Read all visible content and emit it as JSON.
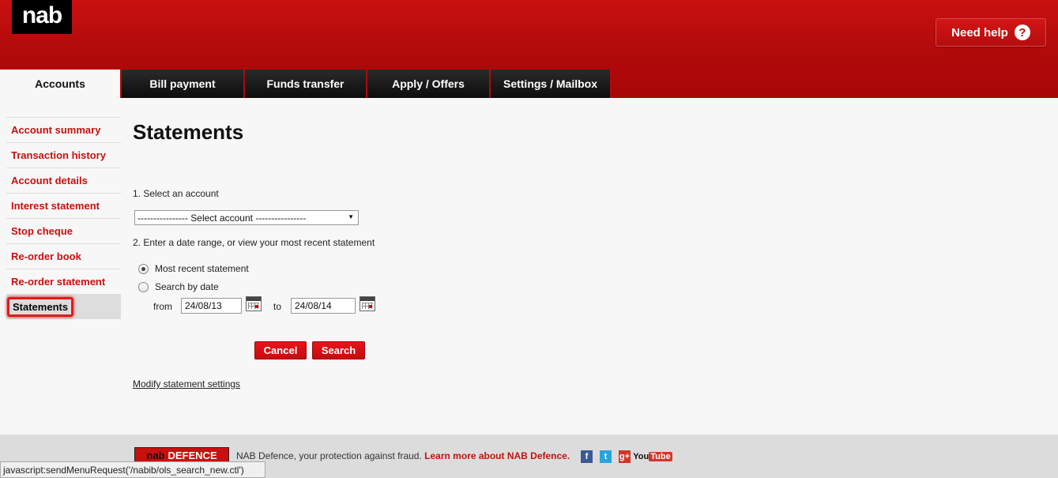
{
  "header": {
    "logo": "nab",
    "need_help": "Need help",
    "help_icon": "?"
  },
  "tabs": [
    {
      "label": "Accounts",
      "active": true
    },
    {
      "label": "Bill payment"
    },
    {
      "label": "Funds transfer"
    },
    {
      "label": "Apply / Offers"
    },
    {
      "label": "Settings / Mailbox"
    }
  ],
  "sidebar": {
    "items": [
      {
        "label": "Account summary"
      },
      {
        "label": "Transaction history"
      },
      {
        "label": "Account details"
      },
      {
        "label": "Interest statement"
      },
      {
        "label": "Stop cheque"
      },
      {
        "label": "Re-order book"
      },
      {
        "label": "Re-order statement"
      },
      {
        "label": "Statements",
        "selected": true
      }
    ]
  },
  "main": {
    "title": "Statements",
    "step1_label": "1. Select an account",
    "account_select": "---------------- Select account ----------------",
    "step2_label": "2. Enter a date range, or view your most recent statement",
    "radio_recent": "Most recent statement",
    "radio_search": "Search by date",
    "from_label": "from",
    "from_date": "24/08/13",
    "to_label": "to",
    "to_date": "24/08/14",
    "cancel_button": "Cancel",
    "search_button": "Search",
    "modify_link": "Modify statement settings"
  },
  "footer": {
    "defence_logo_nab": "nab",
    "defence_logo_text": "DEFENCE",
    "defence_text": "NAB Defence, your protection against fraud.",
    "defence_link": "Learn more about NAB Defence.",
    "facebook": "f",
    "twitter": "t",
    "googleplus": "g+",
    "youtube_you": "You",
    "youtube_tube": "Tube"
  },
  "status_bar": "javascript:sendMenuRequest('/nabib/ols_search_new.ctl')",
  "colors": {
    "brand_red": "#c8100f",
    "tab_dark": "#111111"
  }
}
